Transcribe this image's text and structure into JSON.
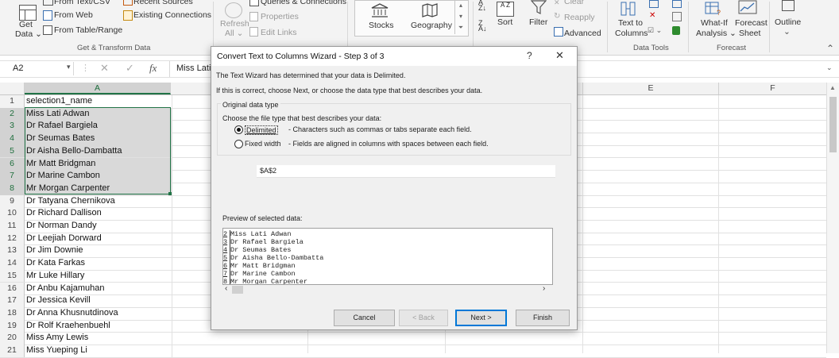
{
  "ribbon": {
    "get_data": {
      "label_line1": "Get",
      "label_line2": "Data"
    },
    "from_text_csv": "From Text/CSV",
    "from_web": "From Web",
    "from_table_range": "From Table/Range",
    "recent_sources": "Recent Sources",
    "existing_connections": "Existing Connections",
    "group_get_transform": "Get & Transform Data",
    "refresh_all": {
      "line1": "Refresh",
      "line2": "All"
    },
    "queries_connections": "Queries & Connections",
    "properties": "Properties",
    "edit_links": "Edit Links",
    "stocks": "Stocks",
    "geography": "Geography",
    "sort": "Sort",
    "filter": "Filter",
    "clear": "Clear",
    "reapply": "Reapply",
    "advanced": "Advanced",
    "text_to_columns": {
      "line1": "Text to",
      "line2": "Columns"
    },
    "group_data_tools": "Data Tools",
    "what_if": {
      "line1": "What-If",
      "line2": "Analysis"
    },
    "forecast_sheet": {
      "line1": "Forecast",
      "line2": "Sheet"
    },
    "group_forecast": "Forecast",
    "outline": "Outline"
  },
  "formula_bar": {
    "name_box": "A2",
    "content": "Miss Lati"
  },
  "columns": {
    "a": "A",
    "e": "E",
    "f": "F"
  },
  "rows": [
    {
      "num": "1",
      "a": "selection1_name"
    },
    {
      "num": "2",
      "a": "Miss Lati Adwan"
    },
    {
      "num": "3",
      "a": "Dr Rafael Bargiela"
    },
    {
      "num": "4",
      "a": "Dr Seumas Bates"
    },
    {
      "num": "5",
      "a": "Dr Aisha Bello-Dambatta"
    },
    {
      "num": "6",
      "a": "Mr Matt Bridgman"
    },
    {
      "num": "7",
      "a": "Dr Marine Cambon"
    },
    {
      "num": "8",
      "a": "Mr Morgan Carpenter"
    },
    {
      "num": "9",
      "a": "Dr Tatyana Chernikova"
    },
    {
      "num": "10",
      "a": "Dr Richard Dallison"
    },
    {
      "num": "11",
      "a": "Dr Norman Dandy"
    },
    {
      "num": "12",
      "a": "Dr Leejiah Dorward"
    },
    {
      "num": "13",
      "a": "Dr Jim Downie"
    },
    {
      "num": "14",
      "a": "Dr Kata Farkas"
    },
    {
      "num": "15",
      "a": "Mr Luke Hillary"
    },
    {
      "num": "16",
      "a": "Dr Anbu Kajamuhan"
    },
    {
      "num": "17",
      "a": "Dr Jessica Kevill"
    },
    {
      "num": "18",
      "a": "Dr Anna Khusnutdinova"
    },
    {
      "num": "19",
      "a": "Dr Rolf Kraehenbuehl"
    },
    {
      "num": "20",
      "a": "Miss Amy Lewis"
    },
    {
      "num": "21",
      "a": "Miss Yueping Li"
    }
  ],
  "dialog": {
    "title": "Convert Text to Columns Wizard - Step 3 of 3",
    "help": "?",
    "close": "✕",
    "intro1": "The Text Wizard has determined that your data is Delimited.",
    "intro2": "If this is correct, choose Next, or choose the data type that best describes your data.",
    "group_title": "Original data type",
    "choose_label": "Choose the file type that best describes your data:",
    "opt_delimited": "Delimited",
    "opt_delimited_desc": "- Characters such as commas or tabs separate each field.",
    "opt_fixed": "Fixed width",
    "opt_fixed_desc": "- Fields are aligned in columns with spaces between each field.",
    "destination_value": "$A$2",
    "preview_label": "Preview of selected data:",
    "preview_lines": [
      {
        "n": "2",
        "t": "Miss Lati Adwan"
      },
      {
        "n": "3",
        "t": "Dr Rafael Bargiela"
      },
      {
        "n": "4",
        "t": "Dr Seumas Bates"
      },
      {
        "n": "5",
        "t": "Dr Aisha Bello-Dambatta"
      },
      {
        "n": "6",
        "t": "Mr Matt Bridgman"
      },
      {
        "n": "7",
        "t": "Dr Marine Cambon"
      },
      {
        "n": "8",
        "t": "Mr Morgan Carpenter"
      }
    ],
    "btn_cancel": "Cancel",
    "btn_back": "< Back",
    "btn_next": "Next >",
    "btn_finish": "Finish"
  },
  "colors": {
    "accent": "#217346",
    "selection": "#d9d9d9",
    "dialog_bg": "#f0f0f0",
    "focus_border": "#0078d7"
  }
}
